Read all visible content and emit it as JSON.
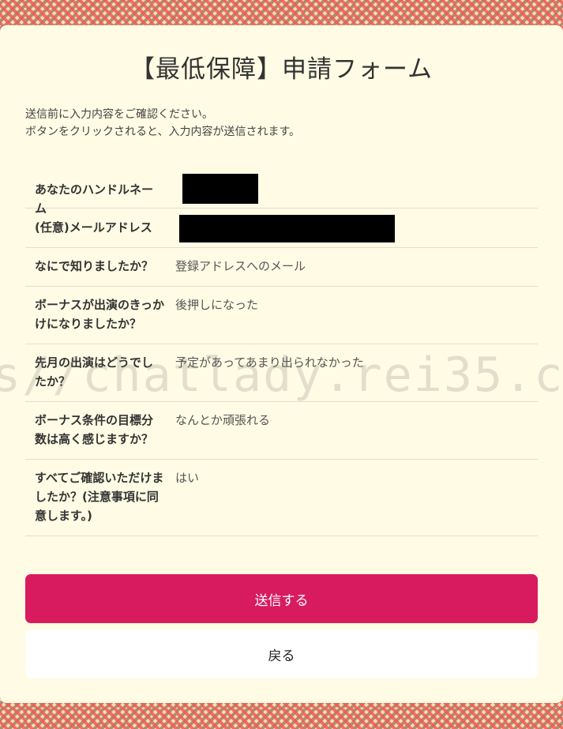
{
  "form": {
    "title": "【最低保障】申請フォーム",
    "intro_line1": "送信前に入力内容をご確認ください。",
    "intro_line2": "ボタンをクリックされると、入力内容が送信されます。",
    "rows": [
      {
        "label": "あなたのハンドルネーム",
        "value": ""
      },
      {
        "label": "(任意)メールアドレス",
        "value": ""
      },
      {
        "label": "なにで知りましたか？",
        "value": "登録アドレスへのメール"
      },
      {
        "label": "ボーナスが出演のきっかけになりましたか？",
        "value": "後押しになった"
      },
      {
        "label": "先月の出演はどうでしたか？",
        "value": "予定があってあまり出られなかった"
      },
      {
        "label": "ボーナス条件の目標分数は高く感じますか？",
        "value": "なんとか頑張れる"
      },
      {
        "label": "すべてご確認いただけましたか？(注意事項に同意します。)",
        "value": "はい"
      }
    ],
    "submit_label": "送信する",
    "back_label": "戻る"
  },
  "watermark": "s//chatlady.rei35.c",
  "colors": {
    "submit_button": "#d81b5f",
    "panel_background": "#fffbe4"
  }
}
